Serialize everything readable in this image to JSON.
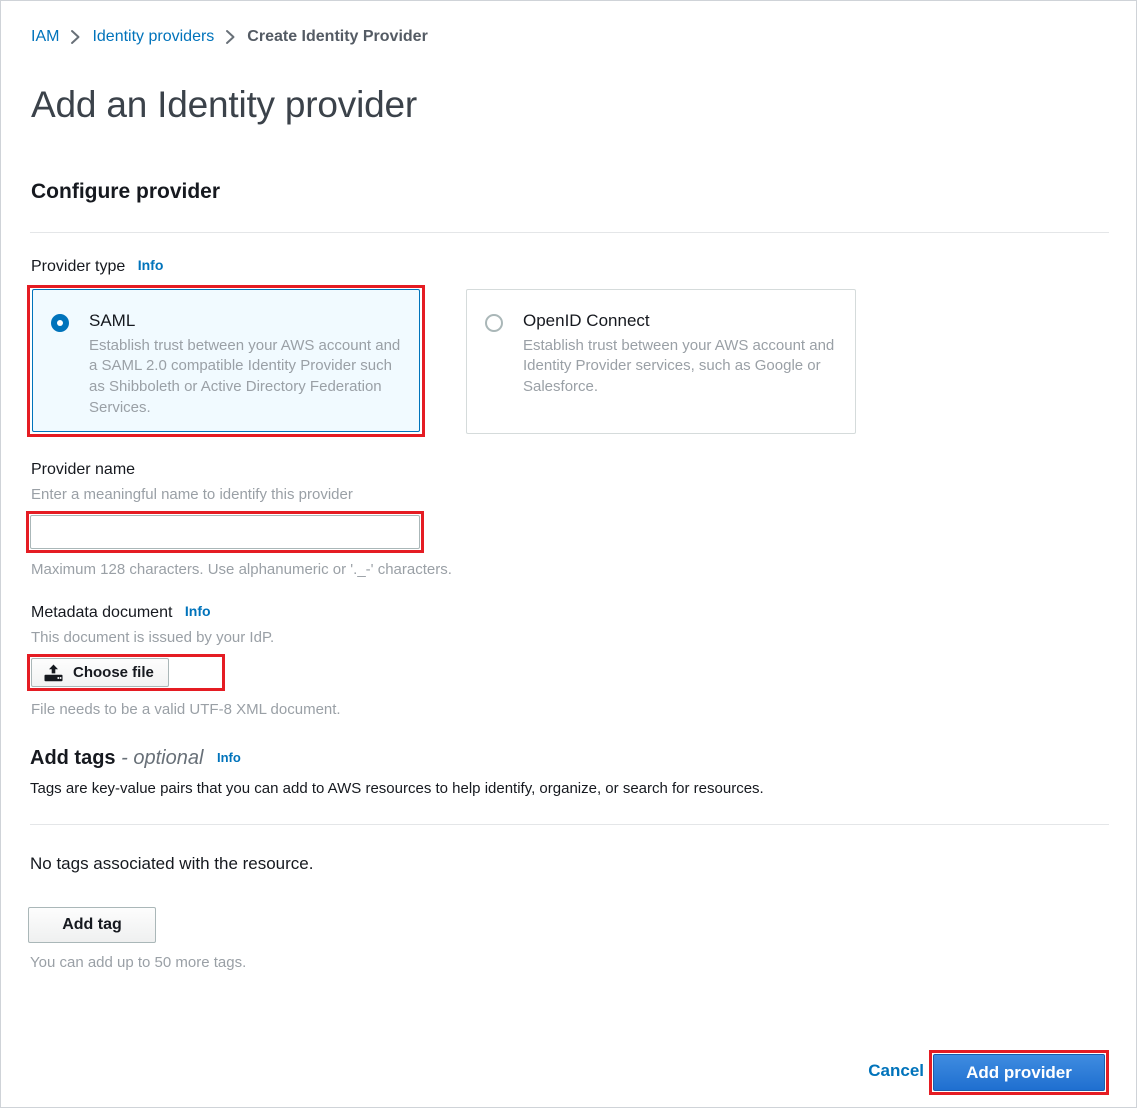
{
  "breadcrumb": {
    "items": [
      {
        "label": "IAM",
        "type": "link"
      },
      {
        "label": "Identity providers",
        "type": "link"
      },
      {
        "label": "Create Identity Provider",
        "type": "current"
      }
    ],
    "separator_icon": "chevron-right-icon"
  },
  "page": {
    "title": "Add an Identity provider",
    "section_heading": "Configure provider"
  },
  "provider_type": {
    "label": "Provider type",
    "info_label": "Info",
    "options": [
      {
        "title": "SAML",
        "description": "Establish trust between your AWS account and a SAML 2.0 compatible Identity Provider such as Shibboleth or Active Directory Federation Services.",
        "selected": true,
        "highlighted": true
      },
      {
        "title": "OpenID Connect",
        "description": "Establish trust between your AWS account and Identity Provider services, such as Google or Salesforce.",
        "selected": false,
        "highlighted": false
      }
    ]
  },
  "provider_name": {
    "label": "Provider name",
    "description": "Enter a meaningful name to identify this provider",
    "value": "",
    "placeholder": "",
    "hint": "Maximum 128 characters. Use alphanumeric or '._-' characters.",
    "highlighted": true
  },
  "metadata_document": {
    "label": "Metadata document",
    "info_label": "Info",
    "description": "This document is issued by your IdP.",
    "choose_file_label": "Choose file",
    "choose_file_icon": "upload-icon",
    "hint": "File needs to be a valid UTF-8 XML document.",
    "highlighted": true
  },
  "add_tags": {
    "heading": "Add tags",
    "optional_suffix": "- optional",
    "info_label": "Info",
    "description": "Tags are key-value pairs that you can add to AWS resources to help identify, organize, or search for resources.",
    "empty_state": "No tags associated with the resource.",
    "add_tag_label": "Add tag",
    "remaining_hint": "You can add up to 50 more tags."
  },
  "footer": {
    "cancel_label": "Cancel",
    "submit_label": "Add provider",
    "submit_highlighted": true
  },
  "colors": {
    "link": "#0073bb",
    "highlight_red": "#e51c23",
    "selected_tile_bg": "#f1faff",
    "primary_button": "#1f6fd0",
    "muted_text": "#9aa0a6"
  }
}
